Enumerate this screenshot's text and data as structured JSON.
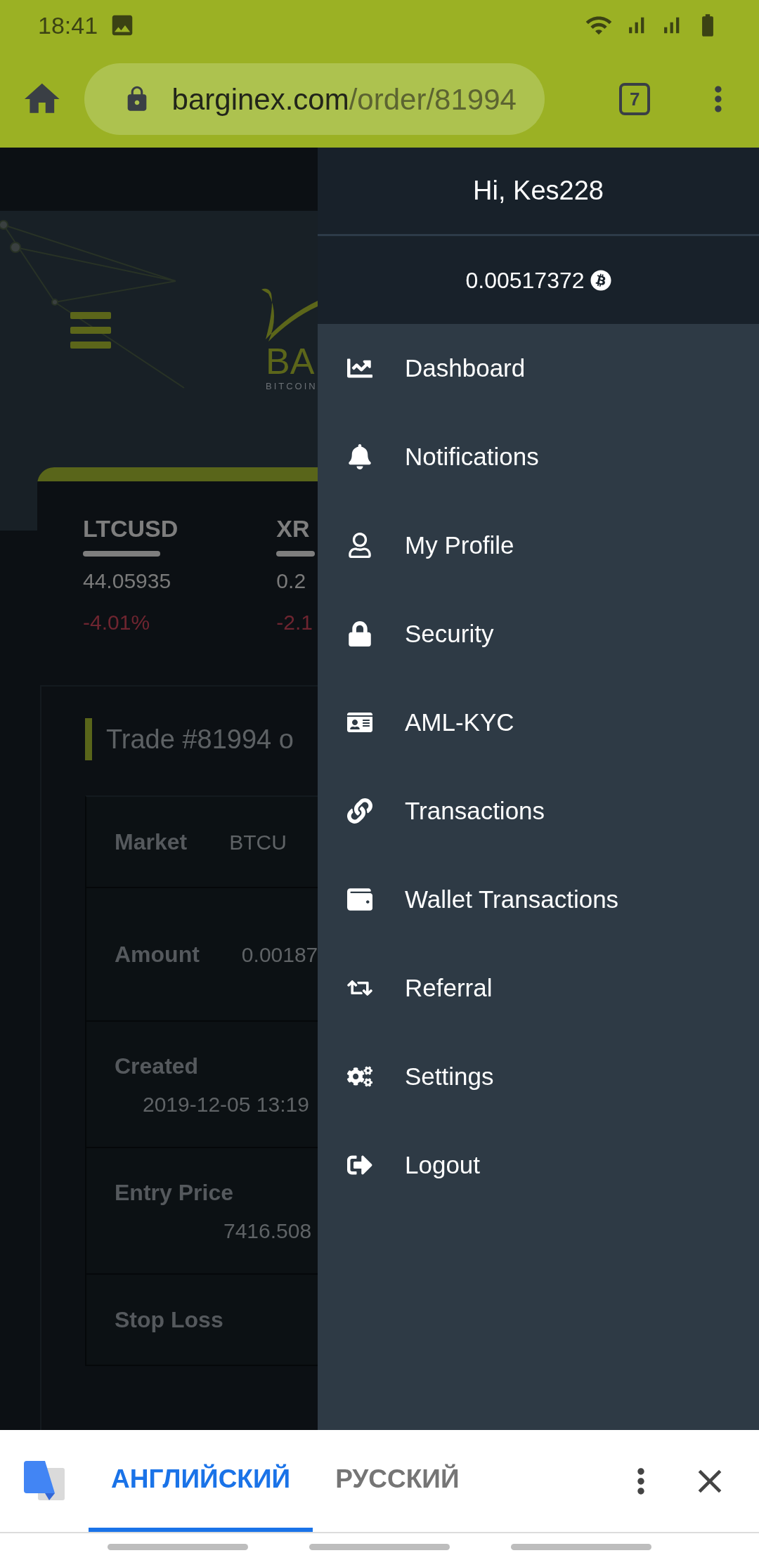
{
  "status_bar": {
    "time": "18:41"
  },
  "browser": {
    "url_domain": "barginex.com",
    "url_path": "/order/81994",
    "tab_count": "7"
  },
  "page": {
    "logo_text": "BA",
    "logo_subtitle": "BITCOIN",
    "tickers": [
      {
        "symbol": "LTCUSD",
        "price": "44.05935",
        "change": "-4.01%"
      },
      {
        "symbol": "XR",
        "price": "0.2",
        "change": "-2.1"
      }
    ],
    "trade": {
      "title": "Trade #81994 o",
      "rows": [
        {
          "kind": "inline",
          "label": "Market",
          "value": "BTCU"
        },
        {
          "kind": "inline",
          "label": "Amount",
          "value": "0.00187"
        },
        {
          "kind": "stacked",
          "label": "Created",
          "value": "2019-12-05 13:19"
        },
        {
          "kind": "indented",
          "label": "Entry Price",
          "value": "7416.508"
        },
        {
          "kind": "inline",
          "label": "Stop Loss"
        }
      ]
    }
  },
  "drawer": {
    "greeting": "Hi, Kes228",
    "balance": "0.00517372",
    "items": [
      {
        "label": "Dashboard"
      },
      {
        "label": "Notifications"
      },
      {
        "label": "My Profile"
      },
      {
        "label": "Security"
      },
      {
        "label": "AML-KYC"
      },
      {
        "label": "Transactions"
      },
      {
        "label": "Wallet Transactions"
      },
      {
        "label": "Referral"
      },
      {
        "label": "Settings"
      },
      {
        "label": "Logout"
      }
    ]
  },
  "translate_bar": {
    "tabs": [
      {
        "label": "АНГЛИЙСКИЙ",
        "selected": true
      },
      {
        "label": "РУССКИЙ",
        "selected": false
      }
    ]
  }
}
